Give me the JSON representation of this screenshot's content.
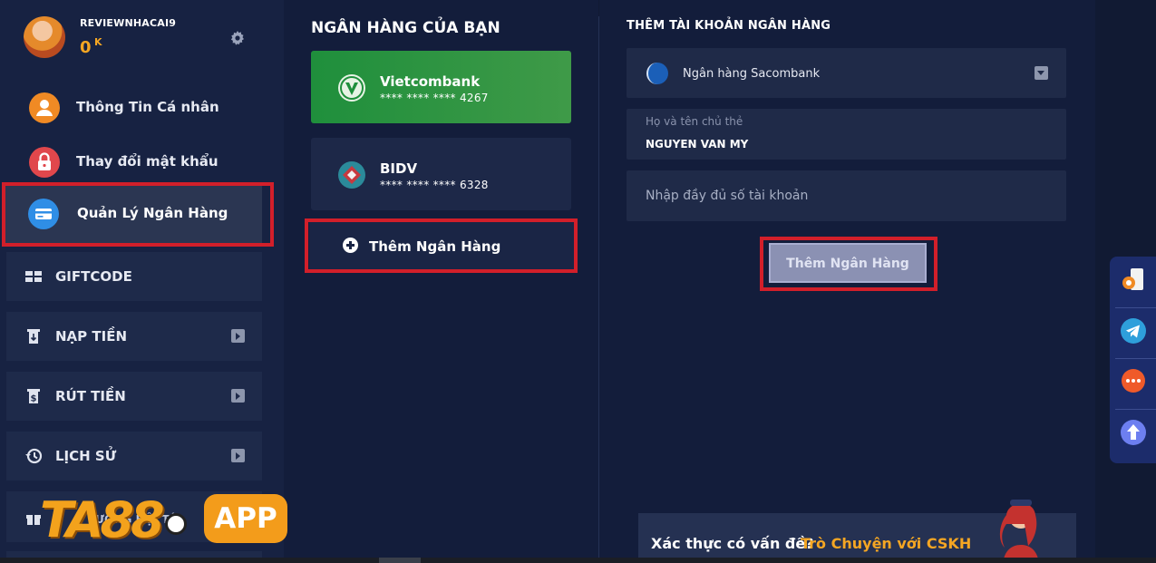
{
  "profile": {
    "username": "REVIEWNHACAI9",
    "balance": "0",
    "balance_unit": "K",
    "settings_icon": "gear-icon"
  },
  "sidebar": {
    "items": [
      {
        "label": "Thông Tin Cá nhân",
        "icon": "user-icon"
      },
      {
        "label": "Thay đổi mật khẩu",
        "icon": "lock-icon"
      },
      {
        "label": "Quản Lý Ngân Hàng",
        "icon": "credit-card-icon"
      }
    ],
    "nav": [
      {
        "label": "GIFTCODE",
        "icon": "gift-card-icon"
      },
      {
        "label": "NẠP TIỀN",
        "icon": "deposit-icon"
      },
      {
        "label": "RÚT TIỀN",
        "icon": "withdraw-icon"
      },
      {
        "label": "LỊCH SỬ",
        "icon": "history-icon"
      }
    ],
    "partial_item_label": "ƯỞNG HỘI TÁ",
    "partial_item_icon": "gift-icon"
  },
  "banks": {
    "title": "NGÂN HÀNG CỦA BẠN",
    "cards": [
      {
        "name": "Vietcombank",
        "number": "**** **** **** 4267",
        "color": "#2a9540"
      },
      {
        "name": "BIDV",
        "number": "**** **** **** 6328",
        "color": "#1d2848"
      }
    ],
    "add_label": "Thêm Ngân Hàng"
  },
  "add_account": {
    "title": "THÊM TÀI KHOẢN NGÂN HÀNG",
    "bank_select": "Ngân hàng Sacombank",
    "holder_label": "Họ và tên chủ thẻ",
    "holder_value": "NGUYEN VAN MY",
    "account_placeholder": "Nhập đầy đủ số tài khoản",
    "submit_label": "Thêm Ngân Hàng"
  },
  "support": {
    "question": "Xác thực có vấn đề?",
    "link": "Trò Chuyện với CSKH"
  },
  "rail": [
    "support-agent-icon",
    "telegram-icon",
    "chat-icon",
    "scroll-up-icon"
  ],
  "brand": {
    "name": "TA88",
    "badge": "APP",
    "accent": "#f39c1b"
  },
  "colors": {
    "highlight": "#d21f2a",
    "accent": "#f5a623",
    "panel": "#131d3b"
  }
}
